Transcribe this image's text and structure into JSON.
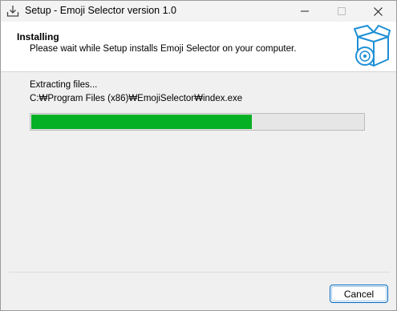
{
  "window": {
    "title": "Setup - Emoji Selector version 1.0"
  },
  "titlebar_buttons": {
    "minimize_icon": "minimize-icon",
    "maximize_icon": "maximize-icon",
    "close_icon": "close-icon"
  },
  "header": {
    "title": "Installing",
    "subtitle": "Please wait while Setup installs Emoji Selector on your computer.",
    "graphic_icon": "install-box-cd-icon"
  },
  "body": {
    "status": "Extracting files...",
    "current_file": "C:₩Program Files (x86)₩EmojiSelector₩index.exe",
    "progress_percent": 66
  },
  "footer": {
    "cancel_label": "Cancel"
  },
  "colors": {
    "progress_fill": "#06b025",
    "progress_track": "#e6e6e6",
    "accent": "#0067c0",
    "header_bg": "#ffffff",
    "window_bg": "#f0f0f0"
  }
}
